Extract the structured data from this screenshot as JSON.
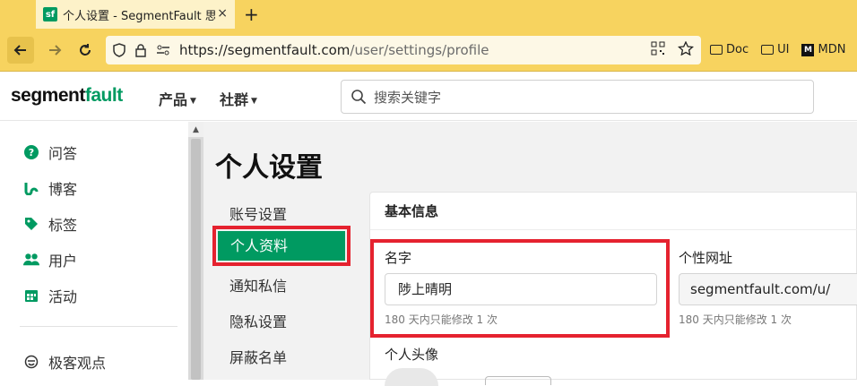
{
  "browser": {
    "tab": {
      "favicon": "sf",
      "title": "个人设置 - SegmentFault 思否",
      "close": "×"
    },
    "new_tab": "+",
    "url": {
      "host": "https://segmentfault.com",
      "path": "/user/settings/profile"
    },
    "bookmarks": [
      {
        "label": "Doc",
        "icon": "folder-icon"
      },
      {
        "label": "UI",
        "icon": "folder-icon"
      },
      {
        "label": "MDN",
        "icon": "mdn-icon"
      }
    ]
  },
  "header": {
    "logo_main": "segment",
    "logo_accent": "fault",
    "menu": [
      {
        "label": "产品"
      },
      {
        "label": "社群"
      }
    ],
    "search_placeholder": "搜索关键字"
  },
  "left_nav": {
    "items": [
      {
        "label": "问答",
        "icon": "question-circle-icon",
        "glyph": "?"
      },
      {
        "label": "博客",
        "icon": "blog-icon",
        "glyph": "ʙ"
      },
      {
        "label": "标签",
        "icon": "tag-icon",
        "glyph": "◆"
      },
      {
        "label": "用户",
        "icon": "users-icon",
        "glyph": "👥"
      },
      {
        "label": "活动",
        "icon": "calendar-icon",
        "glyph": "▦"
      },
      {
        "label": "极客观点",
        "icon": "geek-icon",
        "glyph": "☺"
      }
    ]
  },
  "main": {
    "title": "个人设置",
    "settings_menu": [
      {
        "label": "账号设置"
      },
      {
        "label": "个人资料",
        "active": true
      },
      {
        "label": "通知私信"
      },
      {
        "label": "隐私设置"
      },
      {
        "label": "屏蔽名单"
      }
    ],
    "panel": {
      "heading": "基本信息",
      "name_label": "名字",
      "name_value": "陟上晴明",
      "name_hint": "180 天内只能修改 1 次",
      "url_label": "个性网址",
      "url_prefix": "segmentfault.com/u/",
      "url_hint": "180 天内只能修改 1 次",
      "avatar_label": "个人头像"
    }
  },
  "colors": {
    "brand": "#009a61",
    "highlight": "#e5222f",
    "browser_chrome": "#f7d35f"
  }
}
